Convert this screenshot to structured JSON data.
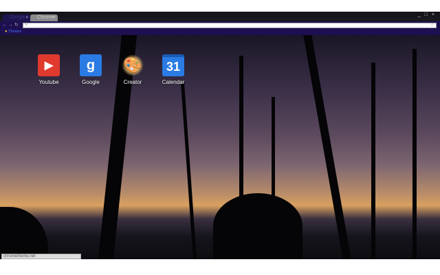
{
  "tabs": [
    {
      "label": "Google"
    },
    {
      "label": "Chrome"
    }
  ],
  "window_controls": "_ □ ×",
  "omnibox": {
    "value": "",
    "placeholder": ""
  },
  "bookmarks": [
    {
      "label": "Themes"
    }
  ],
  "apps": [
    {
      "label": "Youtube",
      "icon": "youtube-icon",
      "color": "#e03a2f"
    },
    {
      "label": "Google",
      "icon": "google-icon",
      "color": "#2a7be4"
    },
    {
      "label": "Creator",
      "icon": "palette-icon",
      "color": "#d9a441"
    },
    {
      "label": "Calendar",
      "icon": "calendar-icon",
      "color": "#2a7be4",
      "glyph": "31"
    }
  ],
  "status": "chrometheme.net"
}
